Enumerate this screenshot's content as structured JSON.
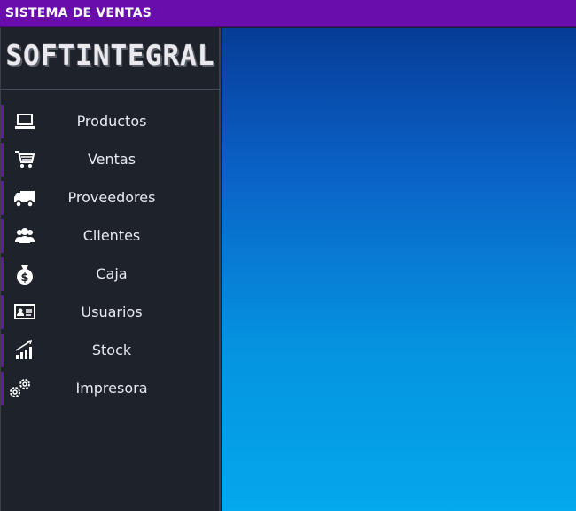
{
  "window": {
    "title": "SISTEMA DE VENTAS"
  },
  "sidebar": {
    "logo": "SOFTINTEGRAL",
    "items": [
      {
        "label": "Productos",
        "icon": "laptop-icon"
      },
      {
        "label": "Ventas",
        "icon": "shopping-cart-icon"
      },
      {
        "label": "Proveedores",
        "icon": "truck-icon"
      },
      {
        "label": "Clientes",
        "icon": "users-icon"
      },
      {
        "label": "Caja",
        "icon": "money-bag-icon"
      },
      {
        "label": "Usuarios",
        "icon": "id-card-icon"
      },
      {
        "label": "Stock",
        "icon": "bar-chart-icon"
      },
      {
        "label": "Impresora",
        "icon": "gears-icon"
      }
    ]
  },
  "colors": {
    "titlebar": "#6a0dad",
    "sidebar": "#1e222b",
    "accent": "#5b1f9f",
    "content_top": "#063c97",
    "content_bottom": "#04a8ec"
  }
}
